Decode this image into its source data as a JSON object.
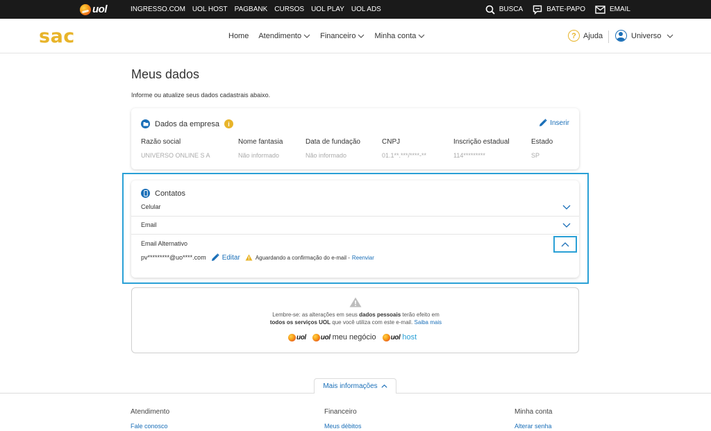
{
  "topbar": {
    "brand": "uol",
    "links": [
      "INGRESSO.COM",
      "UOL HOST",
      "PAGBANK",
      "CURSOS",
      "UOL PLAY",
      "UOL ADS"
    ],
    "right": {
      "search": "BUSCA",
      "chat": "BATE-PAPO",
      "email": "EMAIL"
    }
  },
  "header": {
    "logo": "sac",
    "nav": [
      "Home",
      "Atendimento",
      "Financeiro",
      "Minha conta"
    ],
    "help": "Ajuda",
    "user": "Universo"
  },
  "page": {
    "title": "Meus dados",
    "subtitle": "Informe ou atualize seus dados cadastrais abaixo."
  },
  "company": {
    "title": "Dados da empresa",
    "insert": "Inserir",
    "columns": [
      {
        "label": "Razão social",
        "value": "UNIVERSO ONLINE S A"
      },
      {
        "label": "Nome fantasia",
        "value": "Não informado"
      },
      {
        "label": "Data de fundação",
        "value": "Não informado"
      },
      {
        "label": "CNPJ",
        "value": "01.1**.***/****-**"
      },
      {
        "label": "Inscrição estadual",
        "value": "114*********"
      },
      {
        "label": "Estado",
        "value": "SP"
      }
    ]
  },
  "contacts": {
    "title": "Contatos",
    "rows": [
      "Celular",
      "Email"
    ],
    "alt_label": "Email Alternativo",
    "alt_value": "pv*********@uo****.com",
    "edit": "Editar",
    "warning": "Aguardando a confirmação do e-mail -",
    "resend": "Reenviar"
  },
  "notice": {
    "line1_a": "Lembre-se: as alterações em seus",
    "line1_b": "dados pessoais",
    "line1_c": "terão efeito em",
    "line2_a": "todos os serviços UOL",
    "line2_b": "que você utiliza com este e-mail.",
    "line2_link": "Saiba mais",
    "brands": [
      {
        "name": "uol",
        "suffix": ""
      },
      {
        "name": "uol",
        "suffix": "meu negócio"
      },
      {
        "name": "uol",
        "suffix": "host"
      }
    ]
  },
  "footer": {
    "more": "Mais informações",
    "columns": [
      {
        "heading": "Atendimento",
        "link": "Fale conosco"
      },
      {
        "heading": "Financeiro",
        "link": "Meus débitos"
      },
      {
        "heading": "Minha conta",
        "link": "Alterar senha"
      }
    ]
  },
  "colors": {
    "accent": "#1a6fb8",
    "brand_yellow": "#e8b42a",
    "highlight": "#2aa0d6"
  }
}
